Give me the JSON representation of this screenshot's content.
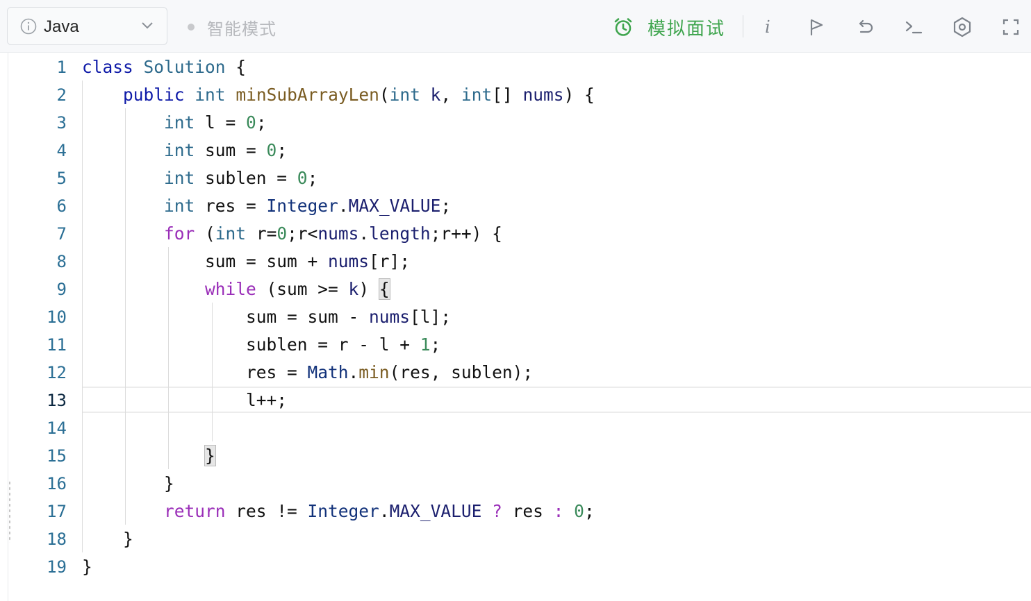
{
  "toolbar": {
    "language": "Java",
    "mode_label": "智能模式",
    "mock_label": "模拟面试",
    "accent_color": "#3fa54e",
    "icons": [
      "info-circle-icon",
      "chevron-down-icon",
      "alarm-clock-icon",
      "italic-info-icon",
      "flag-icon",
      "undo-icon",
      "terminal-icon",
      "settings-icon",
      "fullscreen-icon"
    ]
  },
  "editor": {
    "active_line": "13",
    "line_numbers": [
      "1",
      "2",
      "3",
      "4",
      "5",
      "6",
      "7",
      "8",
      "9",
      "10",
      "11",
      "12",
      "13",
      "14",
      "15",
      "16",
      "17",
      "18",
      "19"
    ],
    "lines": [
      "class Solution {",
      "    public int minSubArrayLen(int k, int[] nums) {",
      "        int l = 0;",
      "        int sum = 0;",
      "        int sublen = 0;",
      "        int res = Integer.MAX_VALUE;",
      "        for (int r=0;r<nums.length;r++) {",
      "            sum = sum + nums[r];",
      "            while (sum >= k) {",
      "                sum = sum - nums[l];",
      "                sublen = r - l + 1;",
      "                res = Math.min(res, sublen);",
      "                l++;",
      "",
      "            }",
      "        }",
      "        return res != Integer.MAX_VALUE ? res : 0;",
      "    }",
      "}"
    ]
  }
}
